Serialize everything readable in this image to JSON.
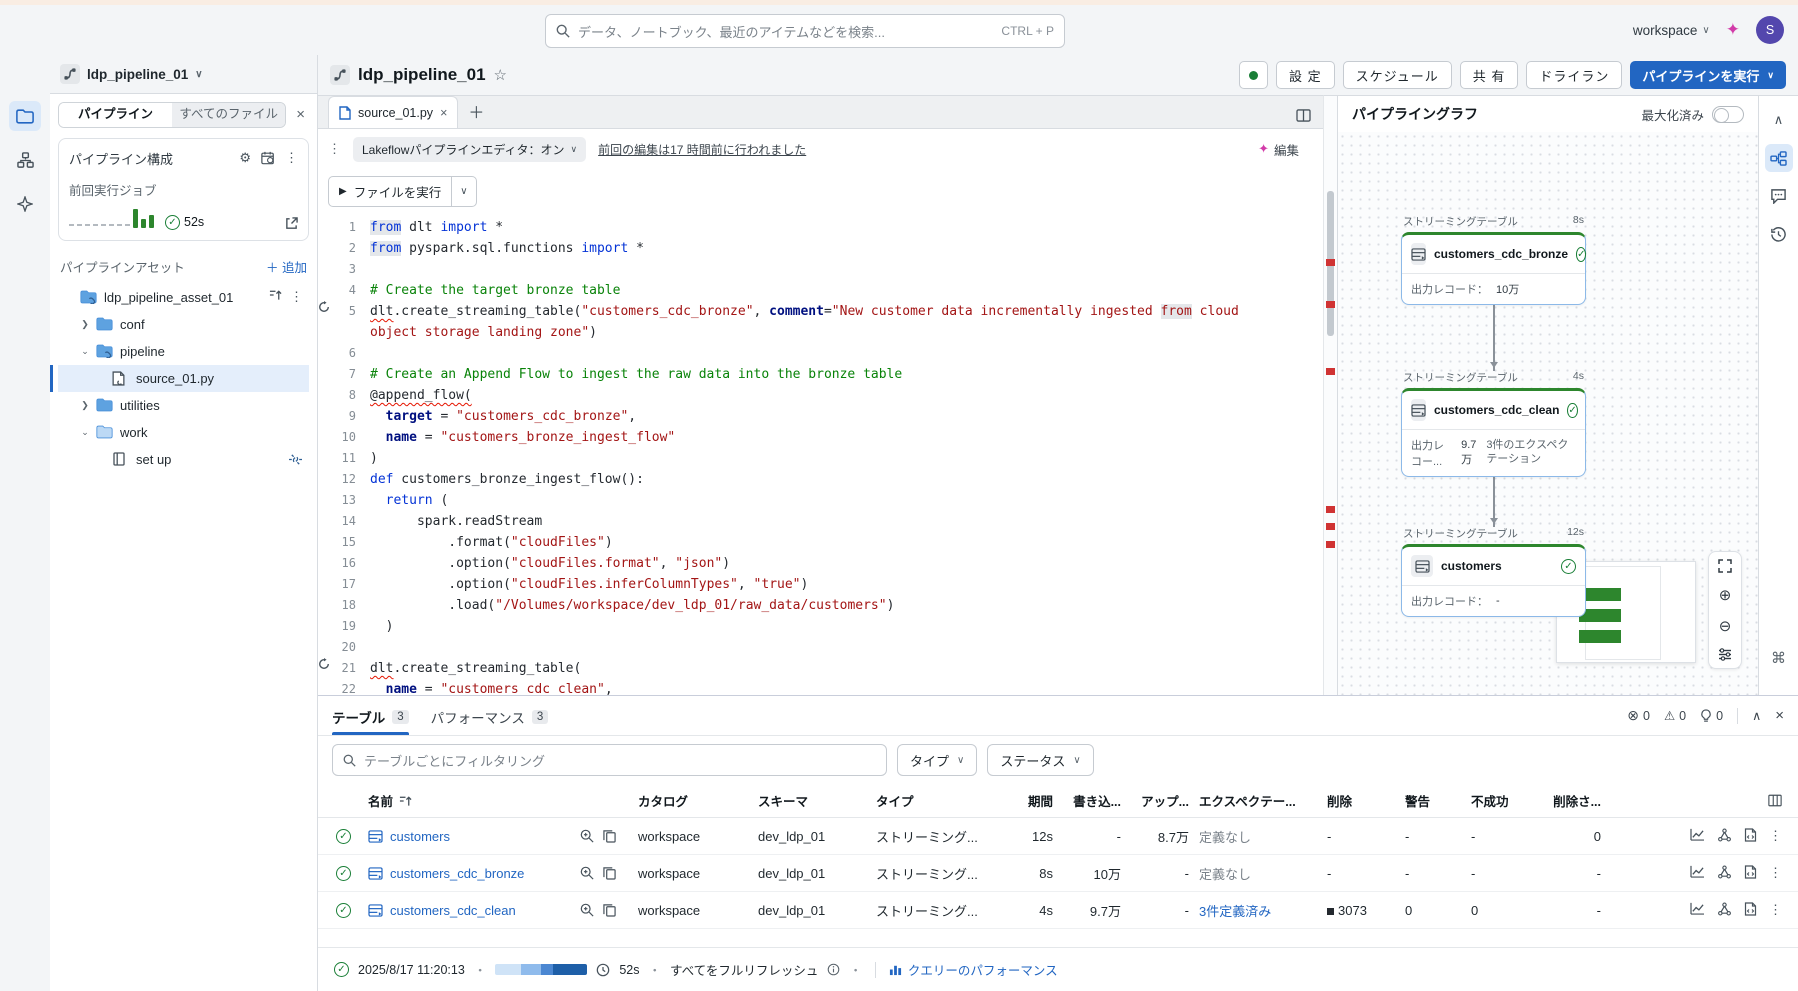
{
  "icons": {
    "chevron_down": "∨",
    "chevron_up": "∧",
    "chevron_right": "›",
    "close": "×",
    "kebab": "⋮",
    "plus": "＋",
    "star": "☆",
    "gear": "⚙",
    "check": "✓",
    "play": "▶",
    "zoom_in": "⊕",
    "zoom_out": "⊖",
    "command": "⌘",
    "warning": "⚠",
    "sparkle": "✦",
    "dot": "●",
    "square": "▪"
  },
  "colors": {
    "accent": "#2266c2",
    "success": "#1a7f37",
    "bar_green": "#2d862d",
    "error_mark": "#d03333",
    "avatar": "#5347ad"
  },
  "topbar": {
    "search_placeholder": "データ、ノートブック、最近のアイテムなどを検索...",
    "search_shortcut": "CTRL + P",
    "workspace_label": "workspace",
    "avatar_initial": "S"
  },
  "sidebar": {
    "pipeline_name": "ldp_pipeline_01",
    "tabs": [
      {
        "label": "パイプライン"
      },
      {
        "label": "すべてのファイル"
      }
    ],
    "config_title": "パイプライン構成",
    "last_run_label": "前回実行ジョブ",
    "last_run_duration": "52s",
    "assets_title": "パイプラインアセット",
    "add_label": "追加",
    "tree": [
      {
        "level": 0,
        "icon": "folder-link",
        "label": "ldp_pipeline_asset_01",
        "chevron": "",
        "trail": "sort-kebab"
      },
      {
        "level": 1,
        "icon": "folder",
        "label": "conf",
        "chevron": "right"
      },
      {
        "level": 1,
        "icon": "folder-link",
        "label": "pipeline",
        "chevron": "down"
      },
      {
        "level": 2,
        "icon": "file-link",
        "label": "source_01.py",
        "selected": true
      },
      {
        "level": 1,
        "icon": "folder",
        "label": "utilities",
        "chevron": "right"
      },
      {
        "level": 1,
        "icon": "folder-open",
        "label": "work",
        "chevron": "down"
      },
      {
        "level": 2,
        "icon": "notebook",
        "label": "set up",
        "trail": "unlink"
      }
    ]
  },
  "header": {
    "title": "ldp_pipeline_01",
    "buttons": [
      "設 定",
      "スケジュール",
      "共 有",
      "ドライラン"
    ],
    "run_button": "パイプラインを実行"
  },
  "editor": {
    "tab": "source_01.py",
    "mode_label": "Lakeflowパイプラインエディタ：オン",
    "last_edit": "前回の編集は17 時間前に行われました",
    "run_file": "ファイルを実行",
    "edit_label": "編集",
    "gutter_icon_lines": [
      5,
      21
    ],
    "lines": [
      [
        [
          "k hl",
          "from"
        ],
        [
          "p",
          " dlt "
        ],
        [
          "k",
          "import"
        ],
        [
          "p",
          " *"
        ]
      ],
      [
        [
          "k hl",
          "from"
        ],
        [
          "p",
          " pyspark.sql.functions "
        ],
        [
          "k",
          "import"
        ],
        [
          "p",
          " *"
        ]
      ],
      [],
      [
        [
          "c",
          "# Create the target bronze table"
        ]
      ],
      [
        [
          "p sq",
          "dlt"
        ],
        [
          "p",
          ".create_streaming_table("
        ],
        [
          "s",
          "\"customers_cdc_bronze\""
        ],
        [
          "p",
          ", "
        ],
        [
          "n",
          "comment"
        ],
        [
          "p",
          "="
        ],
        [
          "s",
          "\"New customer data incrementally ingested "
        ],
        [
          "s hl",
          "from"
        ],
        [
          "s",
          " cloud object storage landing zone\""
        ],
        [
          "p",
          ")"
        ]
      ],
      [],
      [
        [
          "c",
          "# Create an Append Flow to ingest the raw data into the bronze table"
        ]
      ],
      [
        [
          "p sq",
          "@append_flow("
        ]
      ],
      [
        [
          "p",
          "  "
        ],
        [
          "n",
          "target"
        ],
        [
          "p",
          " = "
        ],
        [
          "s",
          "\"customers_cdc_bronze\""
        ],
        [
          "p",
          ","
        ]
      ],
      [
        [
          "p",
          "  "
        ],
        [
          "n",
          "name"
        ],
        [
          "p",
          " = "
        ],
        [
          "s",
          "\"customers_bronze_ingest_flow\""
        ]
      ],
      [
        [
          "p",
          ")"
        ]
      ],
      [
        [
          "k",
          "def"
        ],
        [
          "fn",
          " customers_bronze_ingest_flow"
        ],
        [
          "p",
          "():"
        ]
      ],
      [
        [
          "p",
          "  "
        ],
        [
          "k",
          "return"
        ],
        [
          "p",
          " ("
        ]
      ],
      [
        [
          "p",
          "      spark.readStream"
        ]
      ],
      [
        [
          "p",
          "          .format("
        ],
        [
          "s",
          "\"cloudFiles\""
        ],
        [
          "p",
          ")"
        ]
      ],
      [
        [
          "p",
          "          .option("
        ],
        [
          "s",
          "\"cloudFiles.format\""
        ],
        [
          "p",
          ", "
        ],
        [
          "s",
          "\"json\""
        ],
        [
          "p",
          ")"
        ]
      ],
      [
        [
          "p",
          "          .option("
        ],
        [
          "s",
          "\"cloudFiles.inferColumnTypes\""
        ],
        [
          "p",
          ", "
        ],
        [
          "s",
          "\"true\""
        ],
        [
          "p",
          ")"
        ]
      ],
      [
        [
          "p",
          "          .load("
        ],
        [
          "s",
          "\"/Volumes/workspace/dev_ldp_01/raw_data/customers\""
        ],
        [
          "p",
          ")"
        ]
      ],
      [
        [
          "p",
          "  )"
        ]
      ],
      [],
      [
        [
          "p sq",
          "dlt"
        ],
        [
          "p",
          ".create_streaming_table("
        ]
      ],
      [
        [
          "p",
          "  "
        ],
        [
          "n",
          "name"
        ],
        [
          "p",
          " = "
        ],
        [
          "s",
          "\"customers_cdc_clean\""
        ],
        [
          "p",
          ","
        ]
      ]
    ]
  },
  "graph": {
    "title": "パイプライングラフ",
    "maximized_label": "最大化済み",
    "records_label": "出力レコード：",
    "nodes": [
      {
        "type_label": "ストリーミングテーブル",
        "duration": "8s",
        "name": "customers_cdc_bronze",
        "records_label": "出力レコード：",
        "records": "10万",
        "expectations": ""
      },
      {
        "type_label": "ストリーミングテーブル",
        "duration": "4s",
        "name": "customers_cdc_clean",
        "records_label": "出力レコー...",
        "records": "9.7万",
        "expectations": "3件のエクスペクテーション"
      },
      {
        "type_label": "ストリーミングテーブル",
        "duration": "12s",
        "name": "customers",
        "records_label": "出力レコード：",
        "records": "-",
        "expectations": ""
      }
    ]
  },
  "bottom": {
    "tabs": [
      {
        "label": "テーブル",
        "count": "3"
      },
      {
        "label": "パフォーマンス",
        "count": "3"
      }
    ],
    "counters": {
      "errors": "0",
      "warnings": "0",
      "tips": "0"
    },
    "filter_placeholder": "テーブルごとにフィルタリング",
    "type_filter": "タイプ",
    "status_filter": "ステータス",
    "columns": [
      "名前",
      "カタログ",
      "スキーマ",
      "タイプ",
      "期間",
      "書き込...",
      "アップ...",
      "エクスペクテー...",
      "削除",
      "警告",
      "不成功",
      "削除さ..."
    ],
    "rows": [
      {
        "name": "customers",
        "catalog": "workspace",
        "schema": "dev_ldp_01",
        "type": "ストリーミング...",
        "duration": "12s",
        "written": "-",
        "updated": "8.7万",
        "expectations": "定義なし",
        "exp_link": false,
        "deleted": "-",
        "deleted_bar": false,
        "warnings": "-",
        "failed": "-",
        "dropped": "0"
      },
      {
        "name": "customers_cdc_bronze",
        "catalog": "workspace",
        "schema": "dev_ldp_01",
        "type": "ストリーミング...",
        "duration": "8s",
        "written": "10万",
        "updated": "-",
        "expectations": "定義なし",
        "exp_link": false,
        "deleted": "-",
        "deleted_bar": false,
        "warnings": "-",
        "failed": "-",
        "dropped": "-"
      },
      {
        "name": "customers_cdc_clean",
        "catalog": "workspace",
        "schema": "dev_ldp_01",
        "type": "ストリーミング...",
        "duration": "4s",
        "written": "9.7万",
        "updated": "-",
        "expectations": "3件定義済み",
        "exp_link": true,
        "deleted": "3073",
        "deleted_bar": true,
        "warnings": "0",
        "failed": "0",
        "dropped": "-"
      }
    ],
    "status": {
      "datetime": "2025/8/17 11:20:13",
      "duration": "52s",
      "refresh_label": "すべてをフルリフレッシュ",
      "query_perf_label": "クエリーのパフォーマンス"
    }
  }
}
